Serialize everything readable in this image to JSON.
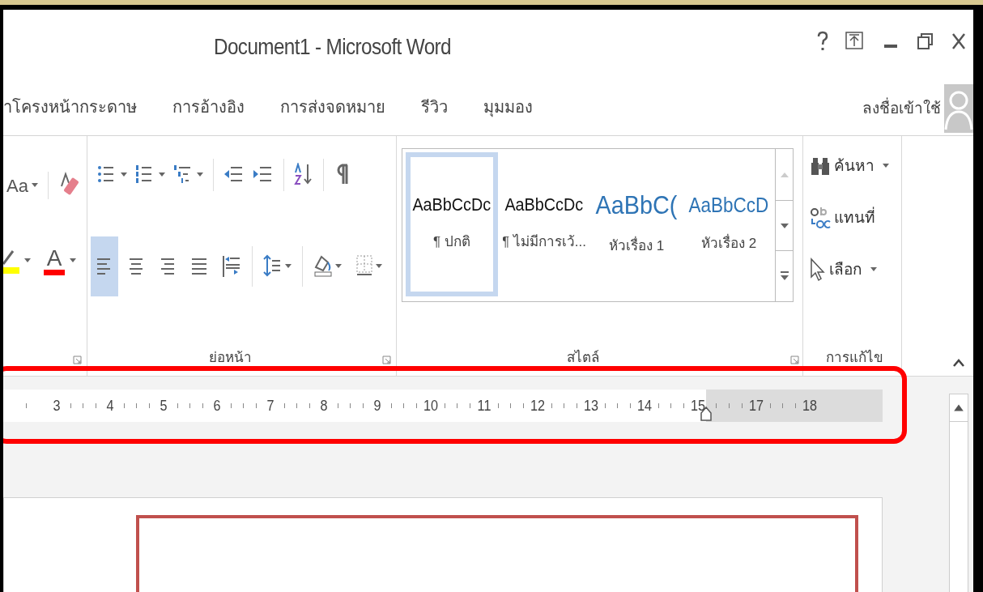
{
  "window": {
    "title": "Document1 - Microsoft Word"
  },
  "tabs": [
    {
      "label": "าโครงหน้ากระดาษ",
      "selected": false
    },
    {
      "label": "การอ้างอิง",
      "selected": false
    },
    {
      "label": "การส่งจดหมาย",
      "selected": false
    },
    {
      "label": "รีวิว",
      "selected": false
    },
    {
      "label": "มุมมอง",
      "selected": false
    }
  ],
  "account": {
    "label": "ลงชื่อเข้าใช้"
  },
  "font_group": {
    "change_case": "Aa",
    "font_color_letter": "A"
  },
  "paragraph_group": {
    "label": "ย่อหน้า",
    "top_row": [
      {
        "kind": "bullets",
        "dropdown": true
      },
      {
        "kind": "numbering",
        "dropdown": true
      },
      {
        "kind": "multilevel",
        "dropdown": true
      },
      {
        "kind": "outdent",
        "dropdown": false
      },
      {
        "kind": "indent",
        "dropdown": false
      },
      {
        "kind": "sort",
        "dropdown": false
      },
      {
        "kind": "marks",
        "dropdown": false
      }
    ],
    "bottom_row": [
      {
        "kind": "left",
        "selected": true
      },
      {
        "kind": "center",
        "selected": false
      },
      {
        "kind": "right",
        "selected": false
      },
      {
        "kind": "justify",
        "selected": false
      },
      {
        "kind": "distributed",
        "selected": false
      },
      {
        "kind": "spacing",
        "dropdown": true
      },
      {
        "kind": "shading",
        "dropdown": true
      },
      {
        "kind": "borders",
        "dropdown": true
      }
    ]
  },
  "styles_group": {
    "label": "สไตล์",
    "styles": [
      {
        "preview": "AaBbCcDc",
        "label": "¶ ปกติ",
        "selected": true,
        "kind": "body"
      },
      {
        "preview": "AaBbCcDc",
        "label": "¶ ไม่มีการเว้...",
        "selected": false,
        "kind": "body"
      },
      {
        "preview": "AaBbC(",
        "label": "หัวเรื่อง 1",
        "selected": false,
        "kind": "heading1"
      },
      {
        "preview": "AaBbCcD",
        "label": "หัวเรื่อง 2",
        "selected": false,
        "kind": "heading2"
      }
    ]
  },
  "editing_group": {
    "label": "การแก้ไข",
    "commands": [
      {
        "kind": "find",
        "label": "ค้นหา",
        "dropdown": true
      },
      {
        "kind": "replace",
        "label": "แทนที่",
        "dropdown": false
      },
      {
        "kind": "select",
        "label": "เลือก",
        "dropdown": true
      }
    ]
  },
  "ruler": {
    "marks": [
      {
        "label": "3",
        "margin": false
      },
      {
        "label": "4",
        "margin": false
      },
      {
        "label": "5",
        "margin": false
      },
      {
        "label": "6",
        "margin": false
      },
      {
        "label": "7",
        "margin": false
      },
      {
        "label": "8",
        "margin": false
      },
      {
        "label": "9",
        "margin": false
      },
      {
        "label": "10",
        "margin": false
      },
      {
        "label": "11",
        "margin": false
      },
      {
        "label": "12",
        "margin": false
      },
      {
        "label": "13",
        "margin": false
      },
      {
        "label": "14",
        "margin": false
      },
      {
        "label": "15",
        "margin": false
      },
      {
        "label": "17",
        "margin": true
      },
      {
        "label": "18",
        "margin": true
      }
    ]
  }
}
